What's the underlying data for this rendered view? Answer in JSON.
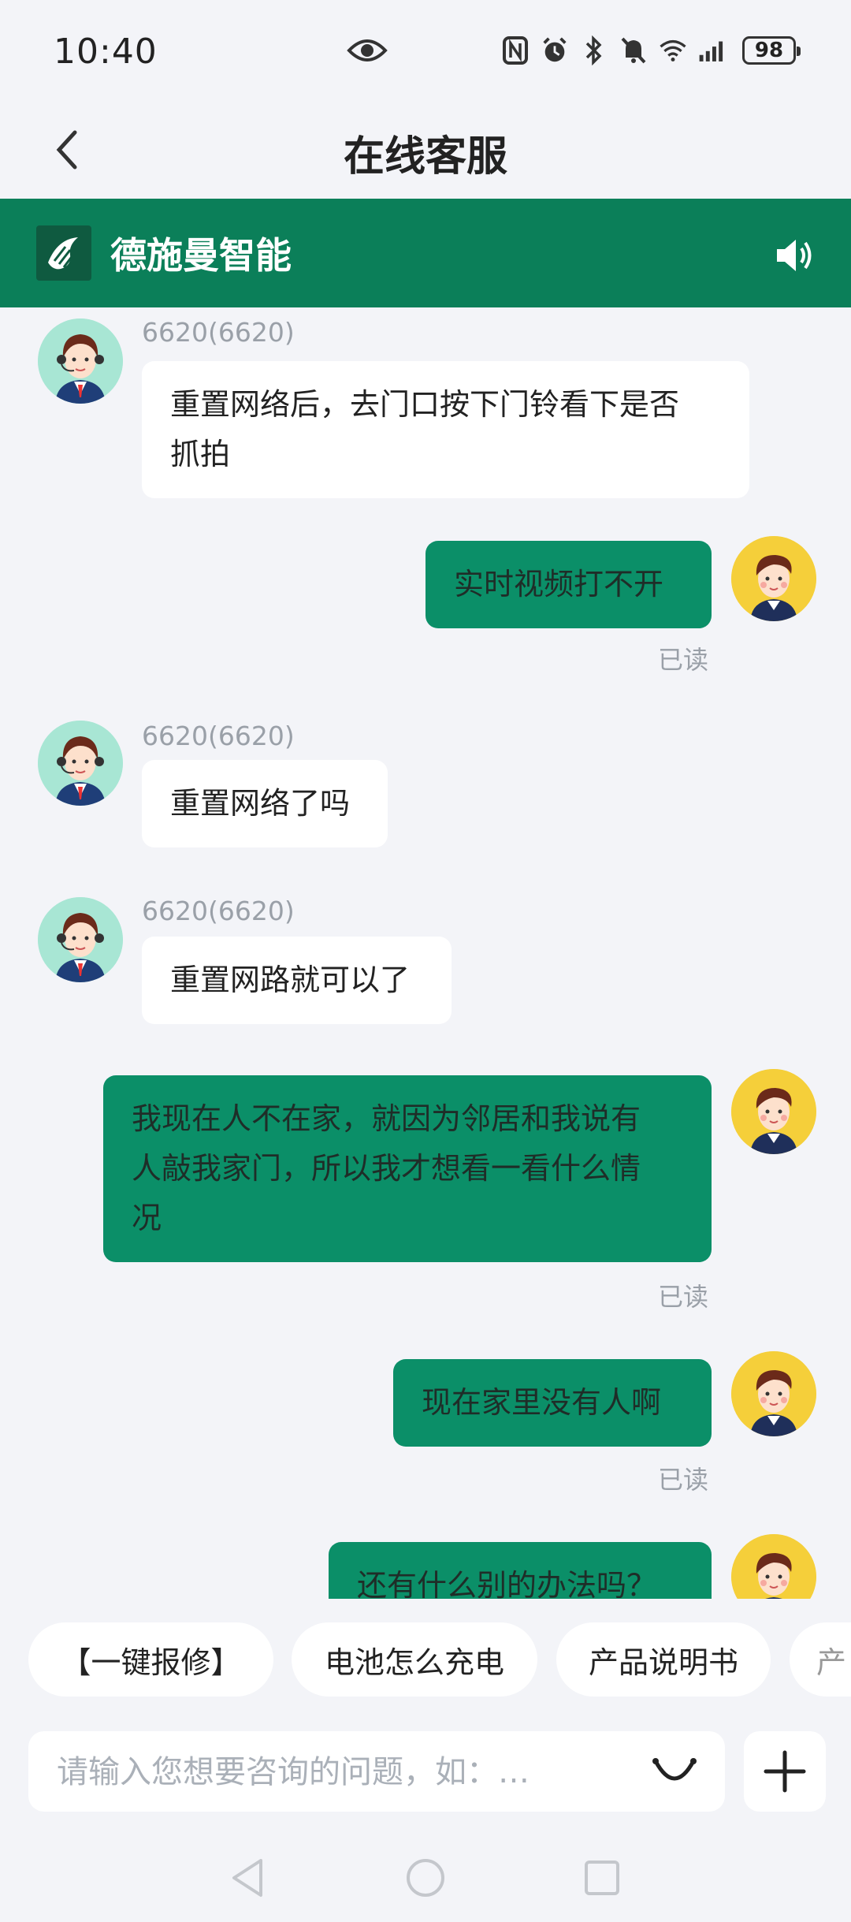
{
  "status_bar": {
    "time": "10:40",
    "battery": "98",
    "icons": [
      "eye-icon",
      "nfc-icon",
      "alarm-icon",
      "bluetooth-icon",
      "mute-icon",
      "wifi-icon",
      "signal-icon"
    ]
  },
  "nav": {
    "title": "在线客服",
    "back_icon": "chevron-left-icon"
  },
  "brand": {
    "name": "德施曼智能",
    "logo_icon": "brand-logo-icon",
    "speaker_icon": "speaker-icon"
  },
  "messages": [
    {
      "from": "agent",
      "sender": "6620(6620)",
      "text_lines": [
        "重置网络后，去门口按下门铃看下是否",
        "抓拍"
      ]
    },
    {
      "from": "user",
      "text_lines": [
        "实时视频打不开"
      ],
      "status": "已读"
    },
    {
      "from": "agent",
      "sender": "6620(6620)",
      "text_lines": [
        "重置网络了吗"
      ]
    },
    {
      "from": "agent",
      "sender": "6620(6620)",
      "text_lines": [
        "重置网路就可以了"
      ]
    },
    {
      "from": "user",
      "text_lines": [
        "我现在人不在家，就因为邻居和我说有",
        "人敲我家门，所以我才想看一看什么情",
        "况"
      ],
      "status": "已读"
    },
    {
      "from": "user",
      "text_lines": [
        "现在家里没有人啊"
      ],
      "status": "已读"
    },
    {
      "from": "user",
      "text_lines": [
        "还有什么别的办法吗？"
      ]
    }
  ],
  "quick_replies": [
    "【一键报修】",
    "电池怎么充电",
    "产品说明书",
    "产"
  ],
  "input": {
    "placeholder": "请输入您想要咨询的问题，如：…",
    "value": ""
  },
  "colors": {
    "brand_green": "#0b7f59",
    "bubble_green": "#0b8f68",
    "background": "#f3f4f8"
  }
}
